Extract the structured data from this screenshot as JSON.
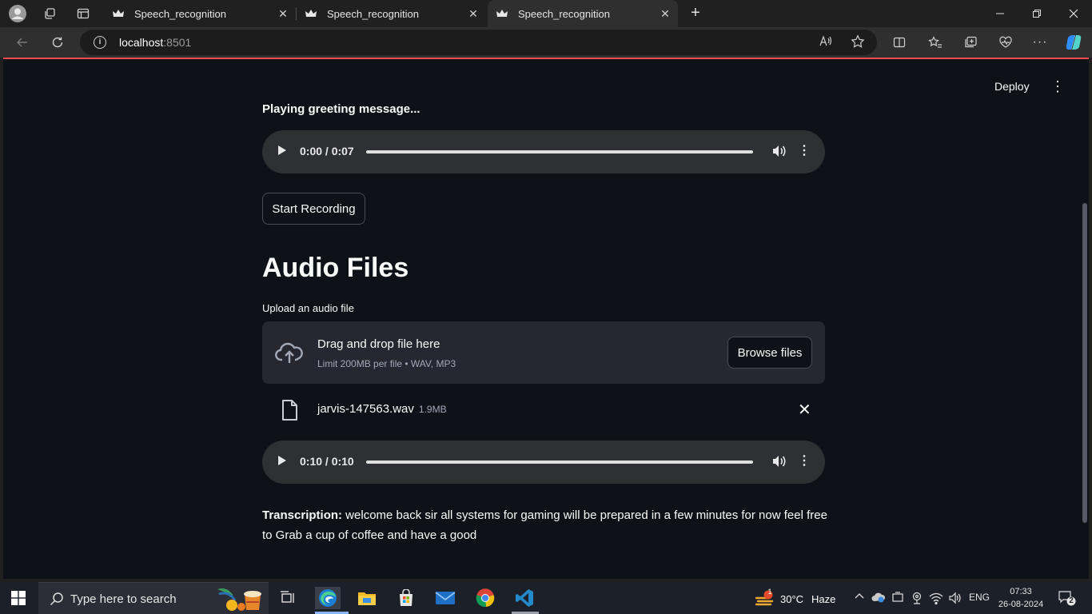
{
  "browser": {
    "tabs": [
      {
        "title": "Speech_recognition"
      },
      {
        "title": "Speech_recognition"
      },
      {
        "title": "Speech_recognition"
      }
    ],
    "url_host": "localhost",
    "url_port": ":8501"
  },
  "app": {
    "deploy_label": "Deploy",
    "greeting": "Playing greeting message...",
    "greeting_audio": {
      "time": "0:00 / 0:07",
      "progress": 0.0
    },
    "record_button": "Start Recording",
    "section_title": "Audio Files",
    "uploader": {
      "label": "Upload an audio file",
      "drop_text": "Drag and drop file here",
      "limit_text": "Limit 200MB per file • WAV, MP3",
      "browse_label": "Browse files"
    },
    "uploaded_file": {
      "name": "jarvis-147563.wav",
      "size": "1.9MB"
    },
    "file_audio": {
      "time": "0:10 / 0:10",
      "progress": 1.0
    },
    "transcription": {
      "label": "Transcription:",
      "text": " welcome back sir all systems for gaming will be prepared in a few minutes for now feel free to Grab a cup of coffee and have a good"
    }
  },
  "taskbar": {
    "search_placeholder": "Type here to search",
    "weather": {
      "temp": "30°C",
      "condition": "Haze",
      "alert_count": "1"
    },
    "language": "ENG",
    "time": "07:33",
    "date": "26-08-2024",
    "notifications": "2"
  },
  "colors": {
    "accent": "#ff4b4b",
    "page_bg": "#0e1117",
    "dropzone_bg": "#262730"
  }
}
